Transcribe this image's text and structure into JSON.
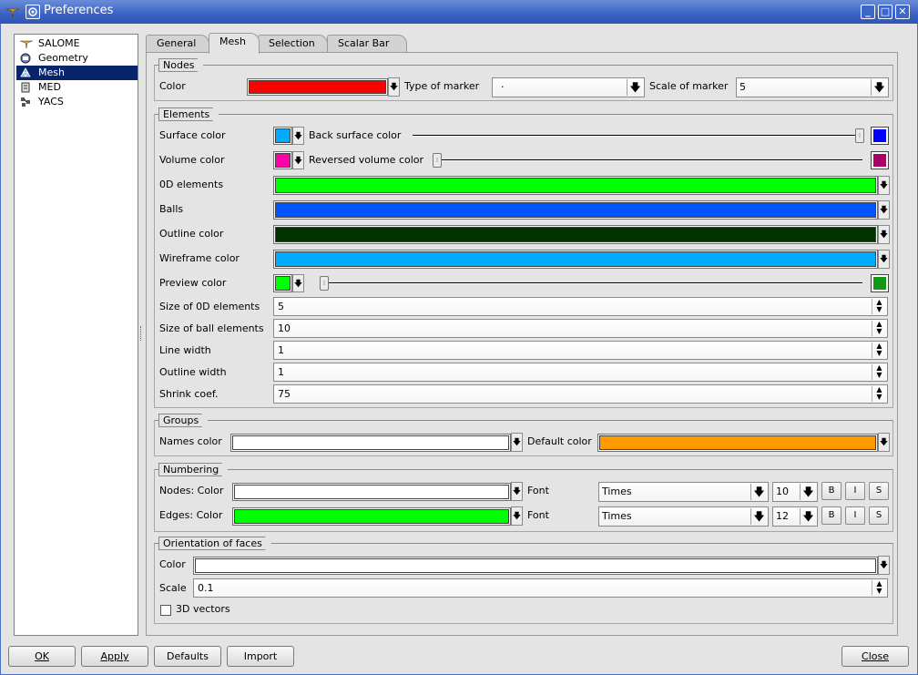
{
  "window": {
    "title": "Preferences"
  },
  "tree": {
    "items": [
      {
        "label": "SALOME",
        "icon": "salome-icon"
      },
      {
        "label": "Geometry",
        "icon": "geometry-icon"
      },
      {
        "label": "Mesh",
        "icon": "mesh-icon",
        "selected": true
      },
      {
        "label": "MED",
        "icon": "med-icon"
      },
      {
        "label": "YACS",
        "icon": "yacs-icon"
      }
    ]
  },
  "tabs": [
    "General",
    "Mesh",
    "Selection",
    "Scalar Bar"
  ],
  "active_tab": "Mesh",
  "nodes": {
    "title": "Nodes",
    "color_label": "Color",
    "color": "#ff0000",
    "marker_label": "Type of marker",
    "marker_value": "·",
    "scale_label": "Scale of marker",
    "scale_value": "5"
  },
  "elements": {
    "title": "Elements",
    "surface_label": "Surface color",
    "surface_color": "#00aaff",
    "back_surface_label": "Back surface color",
    "back_surface_color": "#0000ff",
    "volume_label": "Volume color",
    "volume_color": "#ff00aa",
    "reversed_label": "Reversed volume color",
    "reversed_color": "#aa0066",
    "od_label": "0D elements",
    "od_color": "#00ff00",
    "balls_label": "Balls",
    "balls_color": "#0055ff",
    "outline_label": "Outline color",
    "outline_color": "#003300",
    "wire_label": "Wireframe color",
    "wire_color": "#00aaff",
    "preview_label": "Preview color",
    "preview_color": "#00ff00",
    "preview_right_color": "#119911",
    "size0d_label": "Size of 0D elements",
    "size0d_value": "5",
    "sizeball_label": "Size of ball elements",
    "sizeball_value": "10",
    "linew_label": "Line width",
    "linew_value": "1",
    "outlinew_label": "Outline width",
    "outlinew_value": "1",
    "shrink_label": "Shrink coef.",
    "shrink_value": "75"
  },
  "groups": {
    "title": "Groups",
    "names_label": "Names color",
    "names_color": "#ffffff",
    "default_label": "Default color",
    "default_color": "#ff9900"
  },
  "numbering": {
    "title": "Numbering",
    "nodes_label": "Nodes: Color",
    "nodes_color": "#ffffff",
    "edges_label": "Edges: Color",
    "edges_color": "#00ff00",
    "font_label": "Font",
    "nodes_font": "Times",
    "nodes_size": "10",
    "edges_font": "Times",
    "edges_size": "12",
    "bold": "B",
    "italic": "I",
    "shadow": "S"
  },
  "orientation": {
    "title": "Orientation of faces",
    "color_label": "Color",
    "color": "#ffffff",
    "scale_label": "Scale",
    "scale_value": "0.1",
    "vectors_label": "3D vectors",
    "vectors_checked": false
  },
  "buttons": {
    "ok": "OK",
    "apply": "Apply",
    "defaults": "Defaults",
    "import": "Import",
    "close": "Close"
  }
}
